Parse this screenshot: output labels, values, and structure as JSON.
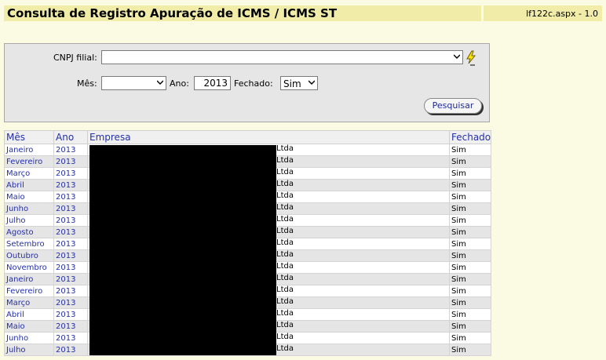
{
  "header": {
    "title": "Consulta de Registro Apuração de ICMS / ICMS ST",
    "version": "lf122c.aspx - 1.0"
  },
  "filters": {
    "cnpj_label": "CNPJ filial:",
    "cnpj_value": "",
    "mes_label": "Mês:",
    "mes_value": "",
    "ano_label": "Ano:",
    "ano_value": "2013",
    "fechado_label": "Fechado:",
    "fechado_value": "Sim",
    "search_button": "Pesquisar"
  },
  "table": {
    "columns": [
      "Mês",
      "Ano",
      "Empresa",
      "Fechado"
    ],
    "rows": [
      {
        "mes": "Janeiro",
        "ano": "2013",
        "empresa": "Ltda",
        "fechado": "Sim"
      },
      {
        "mes": "Fevereiro",
        "ano": "2013",
        "empresa": "Ltda",
        "fechado": "Sim"
      },
      {
        "mes": "Março",
        "ano": "2013",
        "empresa": "Ltda",
        "fechado": "Sim"
      },
      {
        "mes": "Abril",
        "ano": "2013",
        "empresa": "Ltda",
        "fechado": "Sim"
      },
      {
        "mes": "Maio",
        "ano": "2013",
        "empresa": "Ltda",
        "fechado": "Sim"
      },
      {
        "mes": "Junho",
        "ano": "2013",
        "empresa": "Ltda",
        "fechado": "Sim"
      },
      {
        "mes": "Julho",
        "ano": "2013",
        "empresa": "Ltda",
        "fechado": "Sim"
      },
      {
        "mes": "Agosto",
        "ano": "2013",
        "empresa": "Ltda",
        "fechado": "Sim"
      },
      {
        "mes": "Setembro",
        "ano": "2013",
        "empresa": "Ltda",
        "fechado": "Sim"
      },
      {
        "mes": "Outubro",
        "ano": "2013",
        "empresa": "Ltda",
        "fechado": "Sim"
      },
      {
        "mes": "Novembro",
        "ano": "2013",
        "empresa": "Ltda",
        "fechado": "Sim"
      },
      {
        "mes": "Janeiro",
        "ano": "2013",
        "empresa": "Ltda",
        "fechado": "Sim"
      },
      {
        "mes": "Fevereiro",
        "ano": "2013",
        "empresa": "Ltda",
        "fechado": "Sim"
      },
      {
        "mes": "Março",
        "ano": "2013",
        "empresa": "Ltda",
        "fechado": "Sim"
      },
      {
        "mes": "Abril",
        "ano": "2013",
        "empresa": "Ltda",
        "fechado": "Sim"
      },
      {
        "mes": "Maio",
        "ano": "2013",
        "empresa": "Ltda",
        "fechado": "Sim"
      },
      {
        "mes": "Junho",
        "ano": "2013",
        "empresa": "Ltda",
        "fechado": "Sim"
      },
      {
        "mes": "Julho",
        "ano": "2013",
        "empresa": "Ltda",
        "fechado": "Sim"
      }
    ]
  },
  "colors": {
    "title_bar": "#f1eca8",
    "link_blue": "#2530a8",
    "background": "#fbfbe3"
  },
  "icons": {
    "chevron": "chevron-down-icon",
    "lookup": "lightning-icon"
  }
}
